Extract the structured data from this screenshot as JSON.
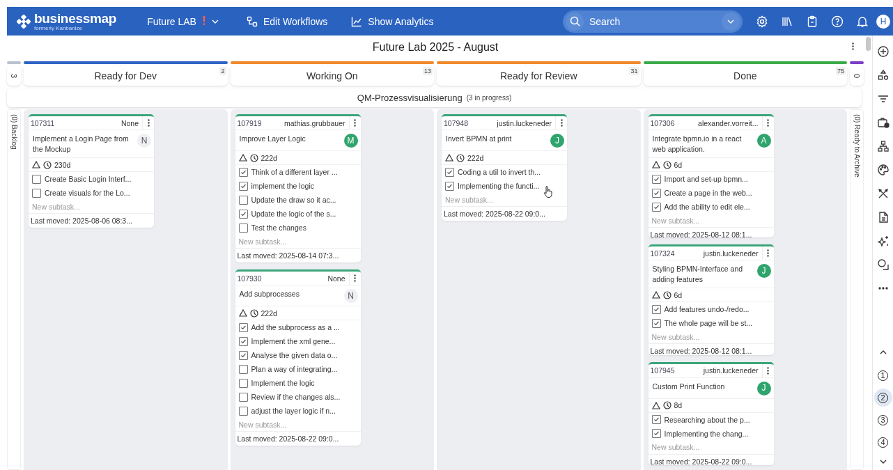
{
  "topbar": {
    "logo": "businessmap",
    "tagline": "formerly Kanbanize",
    "board_name": "Future LAB",
    "alert": "!",
    "items": [
      {
        "kind": "workflow",
        "label": "Edit Workflows"
      },
      {
        "kind": "analytics",
        "label": "Show Analytics"
      }
    ],
    "search": {
      "placeholder": "Search"
    },
    "avatar": "H"
  },
  "board": {
    "title": "Future Lab 2025 - August",
    "left_column": {
      "count": "3",
      "label": "(0) Backlog"
    },
    "right_column": {
      "count": "0",
      "label": "(0) Ready to Archive"
    },
    "columns": [
      {
        "name": "Ready for Dev",
        "count": "2",
        "color": "#2f64c4"
      },
      {
        "name": "Working On",
        "count": "13",
        "color": "#f08a2c"
      },
      {
        "name": "Ready for Review",
        "count": "31",
        "color": "#f08a2c"
      },
      {
        "name": "Done",
        "count": "75",
        "color": "#3cac4a"
      }
    ],
    "swimlane": {
      "name": "QM-Prozessvisualisierung",
      "note": "(3 in progress)"
    },
    "lanes": [
      [
        {
          "id": "107311",
          "owner": "None",
          "title": "Implement a Login Page from the Mockup",
          "avatar": "N",
          "assigned": false,
          "age": "230d",
          "subtasks": [
            {
              "text": "Create Basic Login Interf...",
              "checked": false
            },
            {
              "text": "Create visuals for the Lo...",
              "checked": false
            }
          ],
          "new_subtask": "New subtask...",
          "last_moved": "Last moved: 2025-08-06 08:3..."
        }
      ],
      [
        {
          "id": "107919",
          "owner": "mathias.grubbauer",
          "title": "Improve Layer Logic",
          "avatar": "M",
          "assigned": true,
          "age": "222d",
          "subtasks": [
            {
              "text": "Think of a different layer ...",
              "checked": true
            },
            {
              "text": "implement the logic",
              "checked": true
            },
            {
              "text": "Update the draw so it ac...",
              "checked": false
            },
            {
              "text": "Update the logic of the s...",
              "checked": true
            },
            {
              "text": "Test the changes",
              "checked": false
            }
          ],
          "new_subtask": "New subtask...",
          "last_moved": "Last moved: 2025-08-14 07:3..."
        },
        {
          "id": "107930",
          "owner": "None",
          "title": "Add subprocesses",
          "avatar": "N",
          "assigned": false,
          "age": "222d",
          "subtasks": [
            {
              "text": "Add the subprocess as a ...",
              "checked": true
            },
            {
              "text": "Implement the xml gene...",
              "checked": true
            },
            {
              "text": "Analyse the given data o...",
              "checked": true
            },
            {
              "text": "Plan a way of integrating...",
              "checked": false
            },
            {
              "text": "Implement the logic",
              "checked": false
            },
            {
              "text": "Review if the changes als...",
              "checked": false
            },
            {
              "text": "adjust the layer logic if n...",
              "checked": false
            }
          ],
          "new_subtask": "New subtask...",
          "last_moved": "Last moved: 2025-08-22 09:0..."
        }
      ],
      [
        {
          "id": "107948",
          "owner": "justin.luckeneder",
          "title": "Invert BPMN at print",
          "avatar": "J",
          "assigned": true,
          "age": "222d",
          "subtasks": [
            {
              "text": "Coding a util to invert th...",
              "checked": true
            },
            {
              "text": "Implementing the functi...",
              "checked": true
            }
          ],
          "new_subtask": "New subtask...",
          "last_moved": "Last moved: 2025-08-22 09:0..."
        }
      ],
      [
        {
          "id": "107306",
          "owner": "alexander.vorreit...",
          "title": "Integrate bpmn.io in a react web application.",
          "avatar": "A",
          "assigned": true,
          "age": "6d",
          "subtasks": [
            {
              "text": "Import and set-up bpmn...",
              "checked": true
            },
            {
              "text": "Create a page in the web...",
              "checked": true
            },
            {
              "text": "Add the ability to edit ele...",
              "checked": true
            }
          ],
          "new_subtask": "New subtask...",
          "last_moved": "Last moved: 2025-08-12 08:1..."
        },
        {
          "id": "107324",
          "owner": "justin.luckeneder",
          "title": "Styling BPMN-Interface and adding features",
          "avatar": "J",
          "assigned": true,
          "age": "6d",
          "subtasks": [
            {
              "text": "Add features undo-/redo...",
              "checked": true
            },
            {
              "text": "The whole page will be st...",
              "checked": true
            }
          ],
          "new_subtask": "New subtask...",
          "last_moved": "Last moved: 2025-08-12 08:1..."
        },
        {
          "id": "107945",
          "owner": "justin.luckeneder",
          "title": "Custom Print Function",
          "avatar": "J",
          "assigned": true,
          "age": "8d",
          "subtasks": [
            {
              "text": "Researching about the p...",
              "checked": true
            },
            {
              "text": "Implementing the chang...",
              "checked": true
            }
          ],
          "new_subtask": "New subtask...",
          "last_moved": "Last moved: 2025-08-22 09:0..."
        }
      ]
    ]
  },
  "pages": [
    {
      "label": "1",
      "selected": false
    },
    {
      "label": "2",
      "selected": true
    },
    {
      "label": "3",
      "selected": false
    },
    {
      "label": "4",
      "selected": false
    }
  ]
}
